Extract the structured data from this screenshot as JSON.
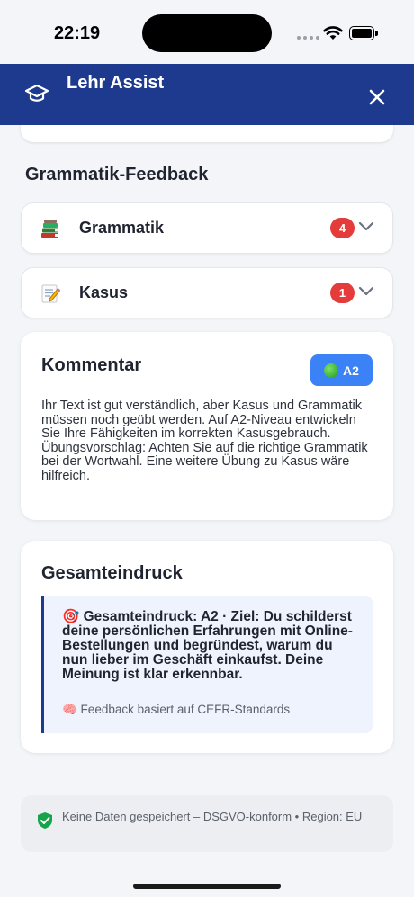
{
  "status_bar": {
    "time": "22:19"
  },
  "header": {
    "title": "Lehr Assist",
    "icon": "graduation-cap-icon",
    "close_icon": "close-icon"
  },
  "section": {
    "title": "Grammatik-Feedback"
  },
  "accordions": [
    {
      "emoji": "books-icon",
      "label": "Grammatik",
      "count": "4"
    },
    {
      "emoji": "memo-icon",
      "label": "Kasus",
      "count": "1"
    }
  ],
  "comment": {
    "title": "Kommentar",
    "level": "A2",
    "text": "Ihr Text ist gut verständlich, aber Kasus und Grammatik müssen noch geübt werden. Auf A2-Niveau entwickeln Sie Ihre Fähigkeiten im korrekten Kasusgebrauch. Übungsvorschlag: Achten Sie auf die richtige Grammatik bei der Wortwahl. Eine weitere Übung zu Kasus wäre hilfreich."
  },
  "overall": {
    "title": "Gesamteindruck",
    "main_text": "🎯 Gesamteindruck: A2 · Ziel: Du schilderst deine persönlichen Erfahrungen mit Online-Bestellungen und begründest, warum du nun lieber im Geschäft einkaufst. Deine Meinung ist klar erkennbar.",
    "footnote": "🧠 Feedback basiert auf CEFR-Standards"
  },
  "privacy": {
    "text": "Keine Daten gespeichert – DSGVO-konform • Region: EU"
  },
  "colors": {
    "header": "#1e3a8f",
    "badge_red": "#e53b3b",
    "level_blue": "#3b82f6",
    "shield_green": "#16a34a"
  }
}
